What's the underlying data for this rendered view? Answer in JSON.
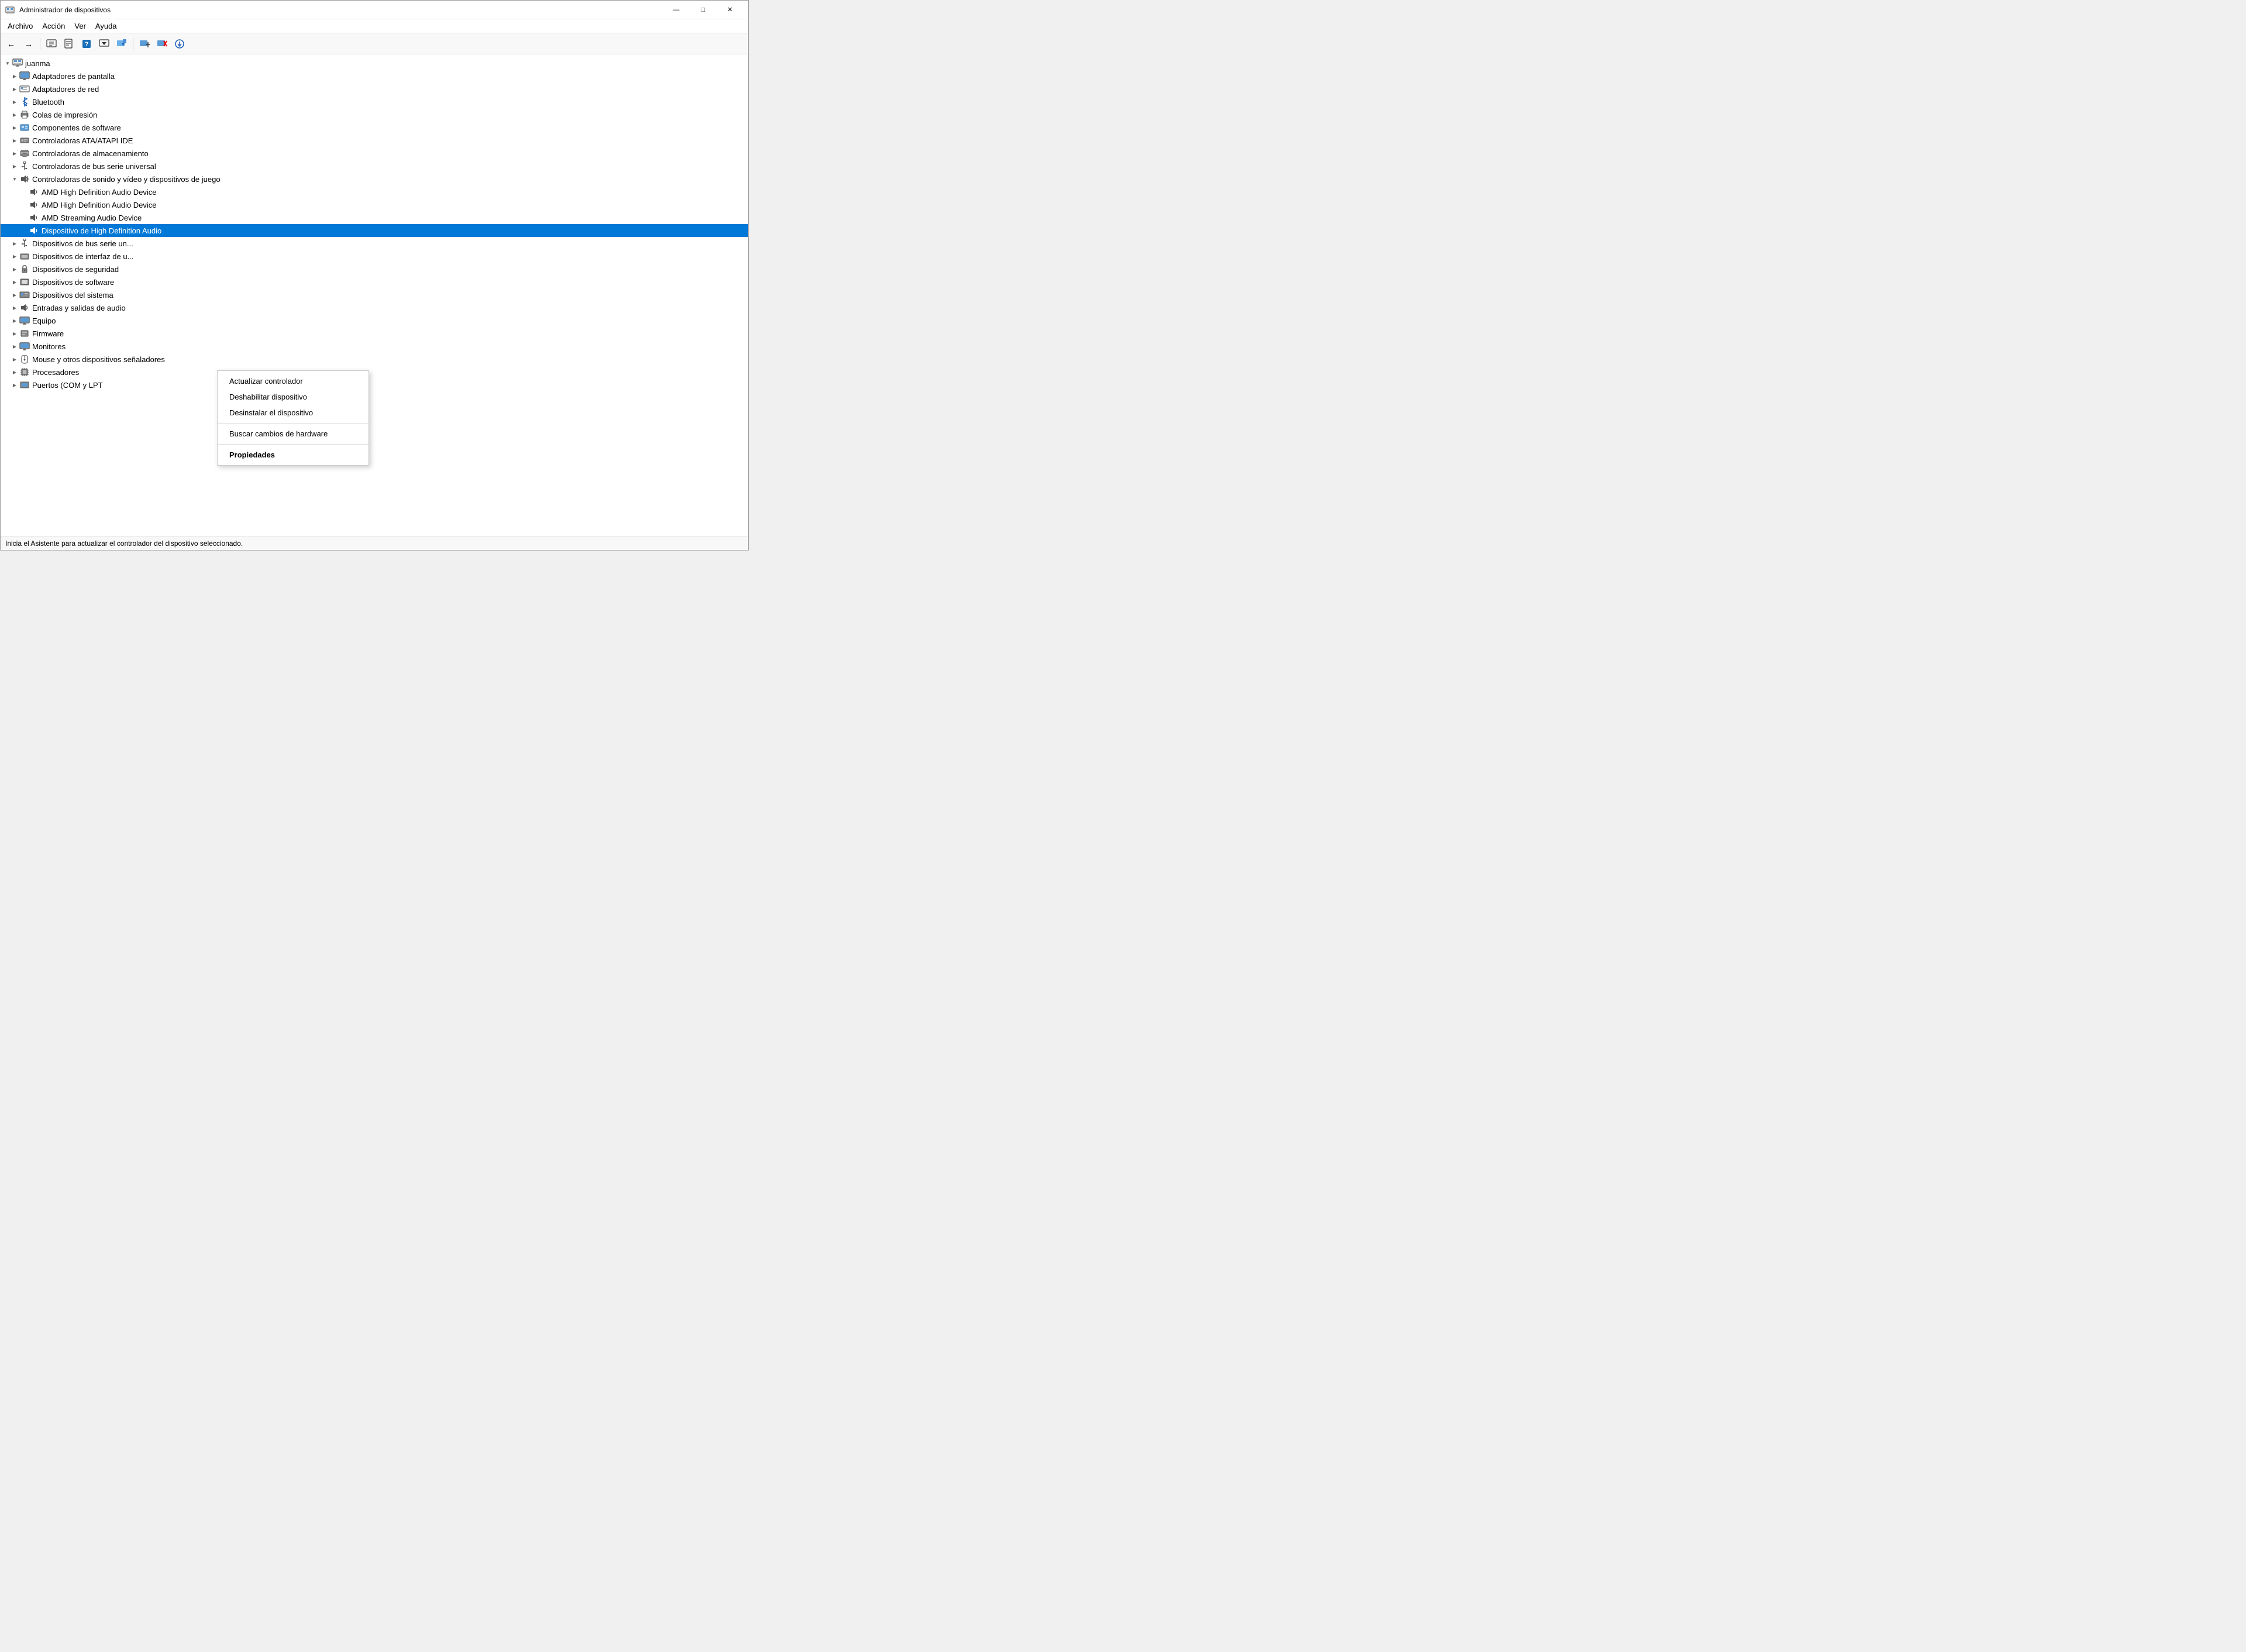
{
  "window": {
    "title": "Administrador de dispositivos",
    "icon": "⚙"
  },
  "titlebar": {
    "minimize": "—",
    "maximize": "□",
    "close": "✕"
  },
  "menu": {
    "items": [
      "Archivo",
      "Acción",
      "Ver",
      "Ayuda"
    ]
  },
  "toolbar": {
    "buttons": [
      {
        "name": "back",
        "icon": "←"
      },
      {
        "name": "forward",
        "icon": "→"
      },
      {
        "name": "show-hide",
        "icon": "▤"
      },
      {
        "name": "properties",
        "icon": "📄"
      },
      {
        "name": "help",
        "icon": "?"
      },
      {
        "name": "update-driver",
        "icon": "▶"
      },
      {
        "name": "refresh",
        "icon": "↻"
      },
      {
        "name": "add-device",
        "icon": "🖥"
      },
      {
        "name": "remove-device",
        "icon": "✕"
      },
      {
        "name": "download",
        "icon": "⬇"
      }
    ]
  },
  "tree": {
    "root": {
      "label": "juanma",
      "expanded": true
    },
    "items": [
      {
        "id": "adaptadores-pantalla",
        "label": "Adaptadores de pantalla",
        "indent": 1,
        "expanded": false,
        "icon": "display"
      },
      {
        "id": "adaptadores-red",
        "label": "Adaptadores de red",
        "indent": 1,
        "expanded": false,
        "icon": "network"
      },
      {
        "id": "bluetooth",
        "label": "Bluetooth",
        "indent": 1,
        "expanded": false,
        "icon": "bluetooth"
      },
      {
        "id": "colas-impresion",
        "label": "Colas de impresión",
        "indent": 1,
        "expanded": false,
        "icon": "printer"
      },
      {
        "id": "componentes-software",
        "label": "Componentes de software",
        "indent": 1,
        "expanded": false,
        "icon": "component"
      },
      {
        "id": "controladoras-ata",
        "label": "Controladoras ATA/ATAPI IDE",
        "indent": 1,
        "expanded": false,
        "icon": "storage"
      },
      {
        "id": "controladoras-almacenamiento",
        "label": "Controladoras de almacenamiento",
        "indent": 1,
        "expanded": false,
        "icon": "storage"
      },
      {
        "id": "controladoras-bus",
        "label": "Controladoras de bus serie universal",
        "indent": 1,
        "expanded": false,
        "icon": "usb"
      },
      {
        "id": "controladoras-sonido",
        "label": "Controladoras de sonido y vídeo y dispositivos de juego",
        "indent": 1,
        "expanded": true,
        "icon": "audio"
      },
      {
        "id": "amd-hda-1",
        "label": "AMD High Definition Audio Device",
        "indent": 2,
        "expanded": false,
        "icon": "audio"
      },
      {
        "id": "amd-hda-2",
        "label": "AMD High Definition Audio Device",
        "indent": 2,
        "expanded": false,
        "icon": "audio"
      },
      {
        "id": "amd-streaming",
        "label": "AMD Streaming Audio Device",
        "indent": 2,
        "expanded": false,
        "icon": "audio"
      },
      {
        "id": "dispositivo-hda",
        "label": "Dispositivo de High Definition Audio",
        "indent": 2,
        "expanded": false,
        "icon": "audio",
        "selected": true
      },
      {
        "id": "dispositivos-bus",
        "label": "Dispositivos de bus serie un...",
        "indent": 1,
        "expanded": false,
        "icon": "usb"
      },
      {
        "id": "dispositivos-interfaz",
        "label": "Dispositivos de interfaz de u...",
        "indent": 1,
        "expanded": false,
        "icon": "device"
      },
      {
        "id": "dispositivos-seguridad",
        "label": "Dispositivos de seguridad",
        "indent": 1,
        "expanded": false,
        "icon": "security"
      },
      {
        "id": "dispositivos-software",
        "label": "Dispositivos de software",
        "indent": 1,
        "expanded": false,
        "icon": "software"
      },
      {
        "id": "dispositivos-sistema",
        "label": "Dispositivos del sistema",
        "indent": 1,
        "expanded": false,
        "icon": "system"
      },
      {
        "id": "entradas-salidas",
        "label": "Entradas y salidas de audio",
        "indent": 1,
        "expanded": false,
        "icon": "audio"
      },
      {
        "id": "equipo",
        "label": "Equipo",
        "indent": 1,
        "expanded": false,
        "icon": "monitor"
      },
      {
        "id": "firmware",
        "label": "Firmware",
        "indent": 1,
        "expanded": false,
        "icon": "firmware"
      },
      {
        "id": "monitores",
        "label": "Monitores",
        "indent": 1,
        "expanded": false,
        "icon": "monitor"
      },
      {
        "id": "mouse",
        "label": "Mouse y otros dispositivos señaladores",
        "indent": 1,
        "expanded": false,
        "icon": "mouse"
      },
      {
        "id": "procesadores",
        "label": "Procesadores",
        "indent": 1,
        "expanded": false,
        "icon": "cpu"
      },
      {
        "id": "puertos",
        "label": "Puertos (COM y LPT",
        "indent": 1,
        "expanded": false,
        "icon": "ports"
      }
    ]
  },
  "context_menu": {
    "items": [
      {
        "id": "actualizar",
        "label": "Actualizar controlador",
        "bold": false,
        "separator_after": false
      },
      {
        "id": "deshabilitar",
        "label": "Deshabilitar dispositivo",
        "bold": false,
        "separator_after": false
      },
      {
        "id": "desinstalar",
        "label": "Desinstalar el dispositivo",
        "bold": false,
        "separator_after": true
      },
      {
        "id": "buscar",
        "label": "Buscar cambios de hardware",
        "bold": false,
        "separator_after": true
      },
      {
        "id": "propiedades",
        "label": "Propiedades",
        "bold": true,
        "separator_after": false
      }
    ]
  },
  "status_bar": {
    "text": "Inicia el Asistente para actualizar el controlador del dispositivo seleccionado."
  }
}
